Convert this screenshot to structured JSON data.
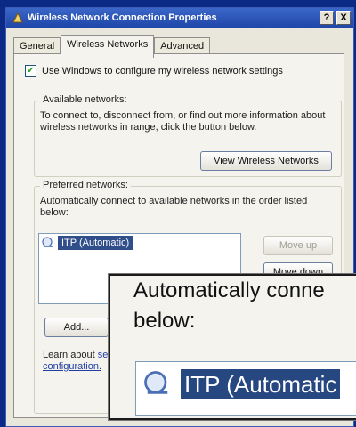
{
  "window": {
    "title": "Wireless Network Connection Properties",
    "help_label": "?",
    "close_label": "X"
  },
  "tabs": [
    {
      "label": "General"
    },
    {
      "label": "Wireless Networks"
    },
    {
      "label": "Advanced"
    }
  ],
  "settings": {
    "use_windows_label": "Use Windows to configure my wireless network settings",
    "use_windows_checked": true
  },
  "available": {
    "legend": "Available networks:",
    "description": "To connect to, disconnect from, or find out more information about wireless networks in range, click the button below.",
    "view_button": "View Wireless Networks"
  },
  "preferred": {
    "legend": "Preferred networks:",
    "description": "Automatically connect to available networks in the order listed below:",
    "items": [
      {
        "label": "ITP (Automatic)"
      }
    ],
    "move_up": "Move up",
    "move_down": "Move down",
    "add_button": "Add..."
  },
  "learn_about": {
    "text": "Learn about",
    "link_fragment": "set",
    "link_line2": "configuration."
  },
  "zoom": {
    "line1": "Automatically conne",
    "line2": "below:",
    "item": "ITP (Automatic"
  },
  "colors": {
    "desktop": "#0b2a86",
    "titlebar": "#2a55b8",
    "selection": "#2f4e8a"
  }
}
